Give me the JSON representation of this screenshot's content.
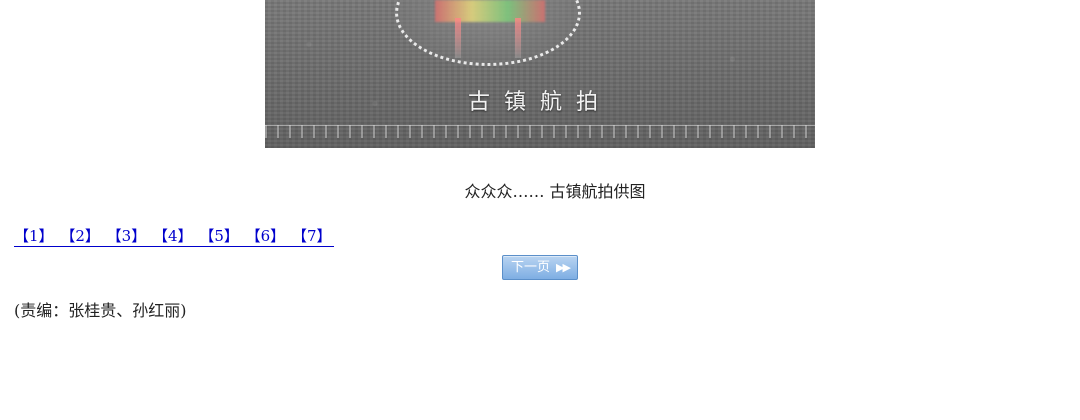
{
  "photo": {
    "overlay_title": "古镇航拍"
  },
  "caption": "众众众…… 古镇航拍供图",
  "pager": {
    "pages": [
      "【1】",
      "【2】",
      "【3】",
      "【4】",
      "【5】",
      "【6】",
      "【7】"
    ]
  },
  "next_button": {
    "label": "下一页",
    "icon": "double-chevron-right-icon"
  },
  "editor_note": "(责编：张桂贵、孙红丽)"
}
